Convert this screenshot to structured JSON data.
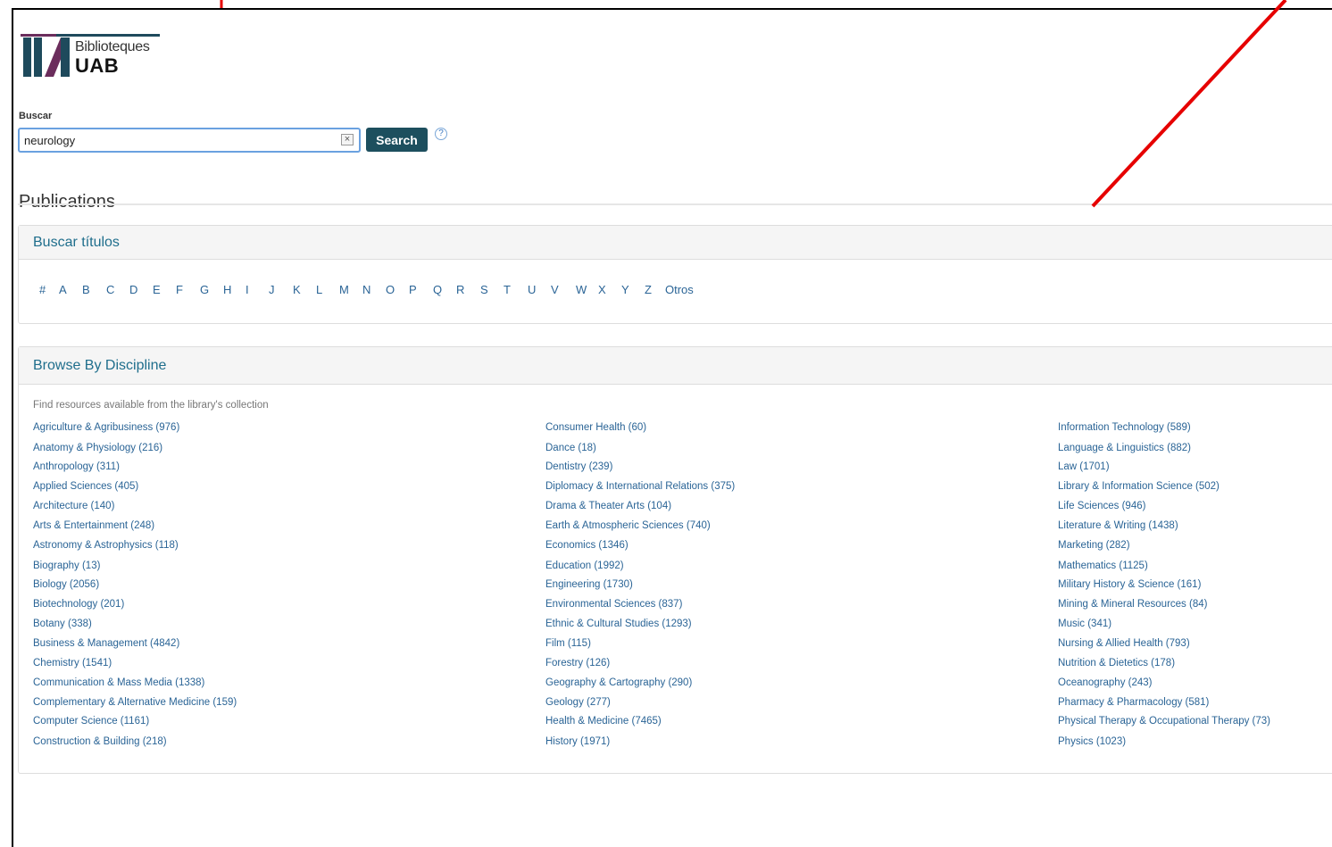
{
  "logo": {
    "line1": "Biblioteques",
    "line2": "UAB",
    "colors": {
      "bars": "#1e4a5c",
      "slash": "#6b2d5c",
      "underline": "#1e4a5c"
    }
  },
  "search": {
    "label": "Buscar",
    "value": "neurology",
    "clear_icon": "close-icon",
    "button_label": "Search",
    "help_label": "?"
  },
  "publications": {
    "heading": "Publications"
  },
  "titles_panel": {
    "heading": "Buscar títulos",
    "letters": [
      "#",
      "A",
      "B",
      "C",
      "D",
      "E",
      "F",
      "G",
      "H",
      "I",
      "J",
      "K",
      "L",
      "M",
      "N",
      "O",
      "P",
      "Q",
      "R",
      "S",
      "T",
      "U",
      "V",
      "W",
      "X",
      "Y",
      "Z",
      "Otros"
    ]
  },
  "discipline_panel": {
    "heading": "Browse By Discipline",
    "intro": "Find resources available from the library's collection",
    "columns": [
      [
        "Agriculture & Agribusiness (976)",
        "Anatomy & Physiology (216)",
        "Anthropology (311)",
        "Applied Sciences (405)",
        "Architecture (140)",
        "Arts & Entertainment (248)",
        "Astronomy & Astrophysics (118)",
        "Biography (13)",
        "Biology (2056)",
        "Biotechnology (201)",
        "Botany (338)",
        "Business & Management (4842)",
        "Chemistry (1541)",
        "Communication & Mass Media (1338)",
        "Complementary & Alternative Medicine (159)",
        "Computer Science (1161)",
        "Construction & Building (218)"
      ],
      [
        "Consumer Health (60)",
        "Dance (18)",
        "Dentistry (239)",
        "Diplomacy & International Relations (375)",
        "Drama & Theater Arts (104)",
        "Earth & Atmospheric Sciences (740)",
        "Economics (1346)",
        "Education (1992)",
        "Engineering (1730)",
        "Environmental Sciences (837)",
        "Ethnic & Cultural Studies (1293)",
        "Film (115)",
        "Forestry (126)",
        "Geography & Cartography (290)",
        "Geology (277)",
        "Health & Medicine (7465)",
        "History (1971)"
      ],
      [
        "Information Technology (589)",
        "Language & Linguistics (882)",
        "Law (1701)",
        "Library & Information Science (502)",
        "Life Sciences (946)",
        "Literature & Writing (1438)",
        "Marketing (282)",
        "Mathematics (1125)",
        "Military History & Science (161)",
        "Mining & Mineral Resources (84)",
        "Music (341)",
        "Nursing & Allied Health (793)",
        "Nutrition & Dietetics (178)",
        "Oceanography (243)",
        "Pharmacy & Pharmacology (581)",
        "Physical Therapy & Occupational Therapy (73)",
        "Physics (1023)"
      ]
    ]
  },
  "annotation_color": "#e60000"
}
